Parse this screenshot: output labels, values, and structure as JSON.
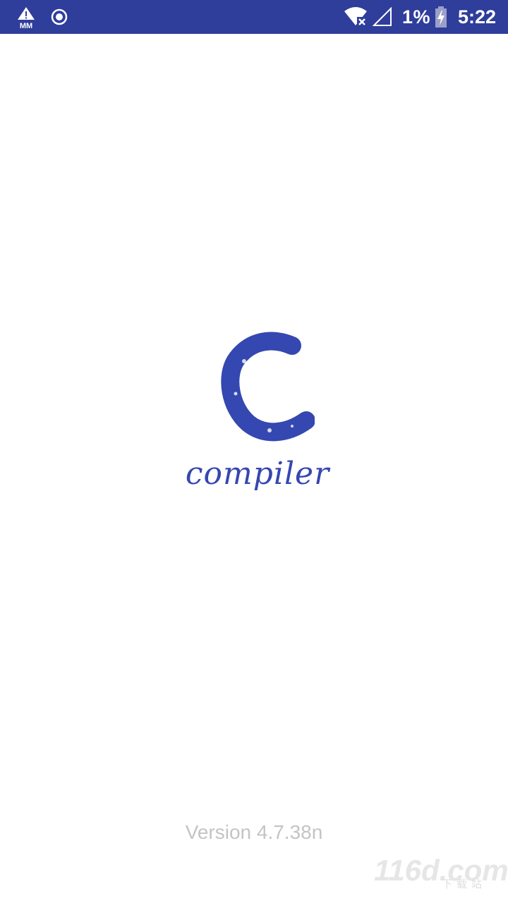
{
  "status_bar": {
    "battery_percent": "1%",
    "time": "5:22",
    "background_color": "#2f3d9b",
    "icons": [
      "warning-mm-icon",
      "record-icon",
      "wifi-off-icon",
      "signal-icon",
      "battery-charging-icon"
    ]
  },
  "splash": {
    "logo_wordmark": "compiler",
    "version": "Version 4.7.38n",
    "accent_color": "#3547b0"
  },
  "watermark": {
    "main": "116d.com",
    "sub": "下载站"
  }
}
